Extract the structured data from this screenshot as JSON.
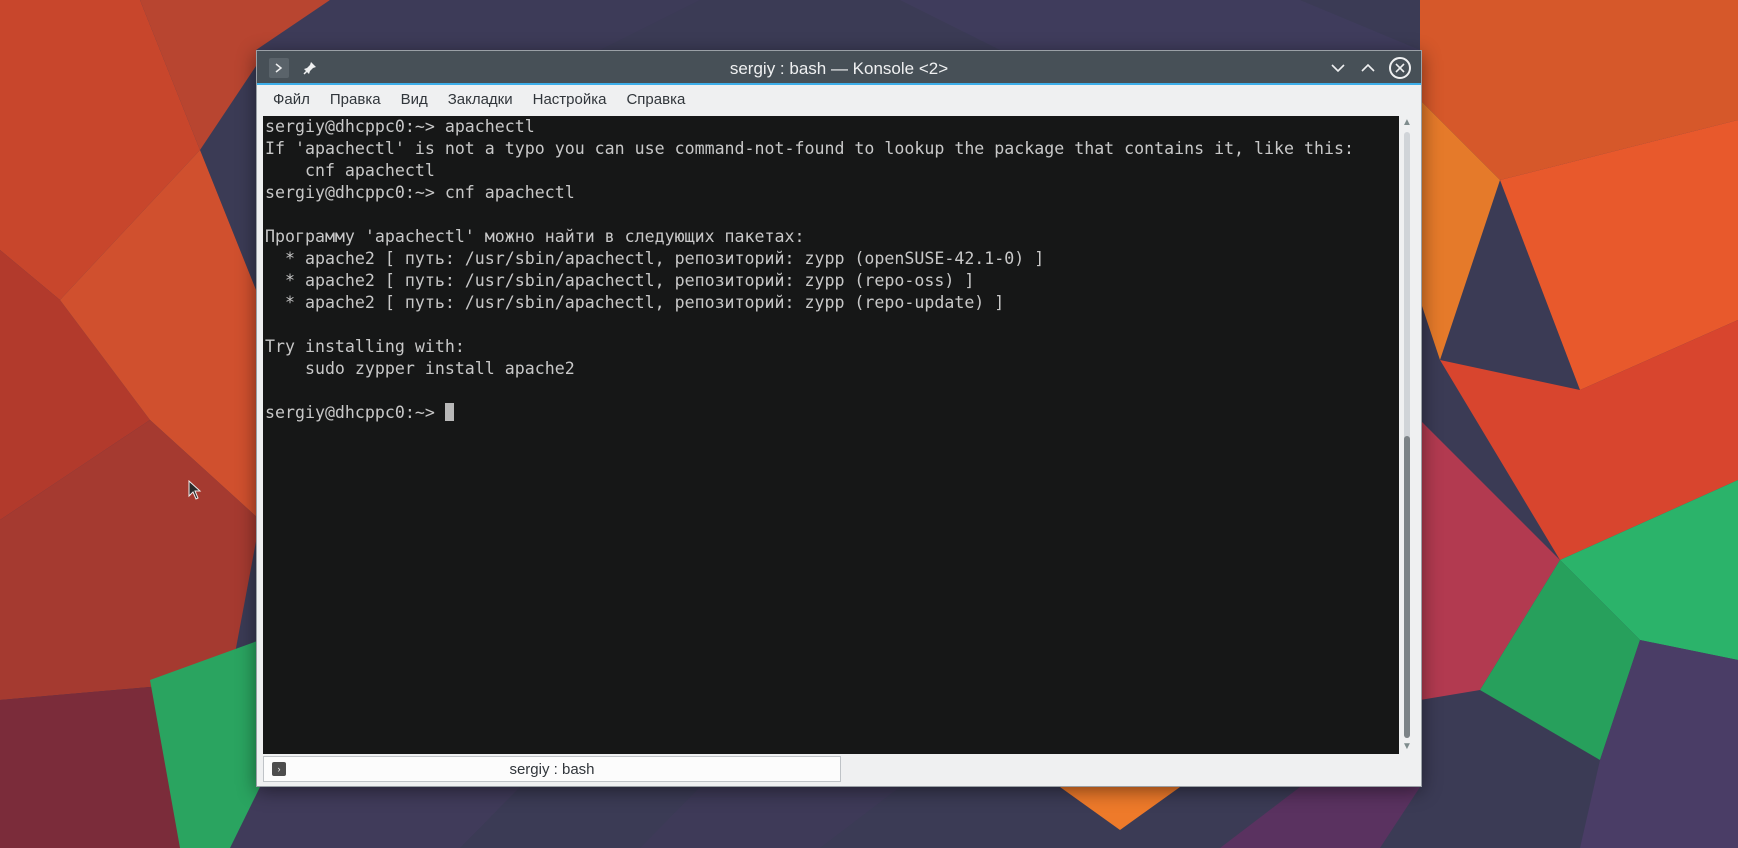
{
  "window": {
    "title": "sergiy : bash — Konsole <2>"
  },
  "menu": {
    "items": [
      "Файл",
      "Правка",
      "Вид",
      "Закладки",
      "Настройка",
      "Справка"
    ]
  },
  "terminal": {
    "lines": [
      "sergiy@dhcppc0:~> apachectl",
      "If 'apachectl' is not a typo you can use command-not-found to lookup the package that contains it, like this:",
      "    cnf apachectl",
      "sergiy@dhcppc0:~> cnf apachectl",
      "",
      "Программу 'apachectl' можно найти в следующих пакетах:",
      "  * apache2 [ путь: /usr/sbin/apachectl, репозиторий: zypp (openSUSE-42.1-0) ]",
      "  * apache2 [ путь: /usr/sbin/apachectl, репозиторий: zypp (repo-oss) ]",
      "  * apache2 [ путь: /usr/sbin/apachectl, репозиторий: zypp (repo-update) ]",
      "",
      "Try installing with:",
      "    sudo zypper install apache2",
      ""
    ],
    "prompt": "sergiy@dhcppc0:~> "
  },
  "tab": {
    "label": "sergiy : bash"
  },
  "icons": {
    "terminal": "terminal-icon",
    "pin": "pin-icon",
    "minimize": "chevron-down-icon",
    "maximize": "chevron-up-icon",
    "close": "close-icon"
  },
  "colors": {
    "titlebar": "#475057",
    "accent": "#3daee9",
    "terminal_bg": "#080808",
    "terminal_fg": "#c8c8c8"
  }
}
